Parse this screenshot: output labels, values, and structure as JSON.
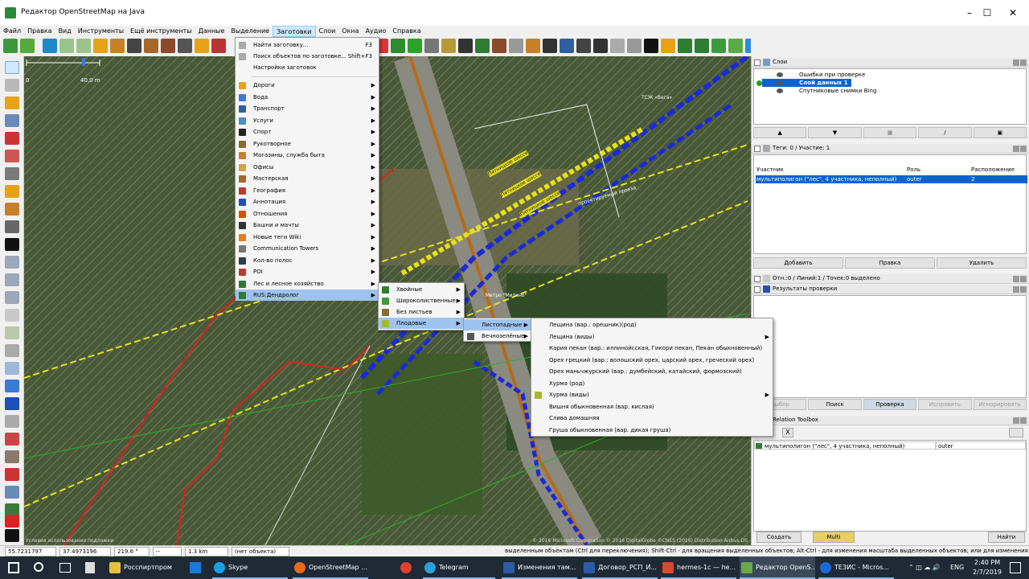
{
  "window": {
    "title": "Редактор OpenStreetMap на Java",
    "background_title": "...документы1 - Word"
  },
  "menubar": [
    "Файл",
    "Правка",
    "Вид",
    "Инструменты",
    "Ещё инструменты",
    "Данные",
    "Выделение",
    "Заготовки",
    "Слои",
    "Окна",
    "Аудио",
    "Справка"
  ],
  "map": {
    "scale_start": "0",
    "scale_end": "40,0 m",
    "attribution": "© 2016 Microsoft Corporation © 2016 DigitalGlobe ©CNES (2016) Distribution Airbus DS",
    "attribution_left": "Условия использования подложки",
    "labels": [
      "Метро \"Митино\"",
      "ТСЖ «Вега»"
    ],
    "street_labels": [
      "Пятницкое шоссе",
      "Пятницкое шоссе",
      "Пятницкое шоссе",
      "проектируемый проезд"
    ]
  },
  "presets_menu": {
    "top_items": [
      {
        "label": "Найти заготовку...",
        "shortcut": "F3"
      },
      {
        "label": "Поиск объектов по заготовке...",
        "shortcut": "Shift+F3"
      },
      {
        "label": "Настройки заготовок",
        "shortcut": ""
      }
    ],
    "groups": [
      {
        "label": "Дороги",
        "color": "#e8a21a"
      },
      {
        "label": "Вода",
        "color": "#3a7bd5"
      },
      {
        "label": "Транспорт",
        "color": "#2f5f9e"
      },
      {
        "label": "Услуги",
        "color": "#4a90c8"
      },
      {
        "label": "Спорт",
        "color": "#222222"
      },
      {
        "label": "Рукотворное",
        "color": "#8b6b2e"
      },
      {
        "label": "Магазины, служба быта",
        "color": "#c7802a"
      },
      {
        "label": "Офисы",
        "color": "#d2a24c"
      },
      {
        "label": "Мастерская",
        "color": "#a5682a"
      },
      {
        "label": "География",
        "color": "#c0392b"
      },
      {
        "label": "Аннотация",
        "color": "#1f4fb8"
      },
      {
        "label": "Отношения",
        "color": "#d35400"
      },
      {
        "label": "Башни и мачты",
        "color": "#333333"
      },
      {
        "label": "Новые теги Wiki",
        "color": "#e67e22"
      },
      {
        "label": "Communication Towers",
        "color": "#777777"
      },
      {
        "label": "Кол-во полос",
        "color": "#2c3e50"
      },
      {
        "label": "POI",
        "color": "#c0392b"
      },
      {
        "label": "Лес и лесное хозяйство",
        "color": "#2e7d32"
      },
      {
        "label": "RUS:Дендролог",
        "color": "#2e7d32"
      }
    ]
  },
  "dendrolog_menu": [
    {
      "label": "Хвойные"
    },
    {
      "label": "Широколиственные"
    },
    {
      "label": "Без листьев"
    },
    {
      "label": "Плодовые"
    }
  ],
  "fruit_menu": [
    {
      "label": "Листопадные"
    },
    {
      "label": "Вечнозелёные"
    }
  ],
  "deciduous_menu": [
    {
      "label": "Лещина (вар.: орешник)(род)",
      "sub": false
    },
    {
      "label": "Лещина (виды)",
      "sub": true
    },
    {
      "label": "Кария пекан (вар.: иллинойсская, Гикори пекан, Пекан обыкновенный)",
      "sub": false
    },
    {
      "label": "Орех грецкий (вар.: волошский орех, царский орех, греческий орех)",
      "sub": false
    },
    {
      "label": "Орех маньчжурский (вар.: думбейский, катайский, формозский)",
      "sub": false
    },
    {
      "label": "Хурма (род)",
      "sub": false
    },
    {
      "label": "Хурма (виды)",
      "sub": true
    },
    {
      "label": "Вишня обыкновенная (вар. кислая)",
      "sub": false
    },
    {
      "label": "Слива домашняя",
      "sub": false
    },
    {
      "label": "Груша обыкновенная (вар. дикая груша)",
      "sub": false
    }
  ],
  "layers_panel": {
    "title": "Слои",
    "layers": [
      "Ошибки при проверке",
      "Слой данных 1",
      "Спутниковые снимки Bing"
    ]
  },
  "tags_panel": {
    "title": "Теги: 0 / Участие: 1",
    "columns": [
      "Участник",
      "Роль",
      "Расположение"
    ],
    "row": {
      "member": "мультиполигон (\"лес\", 4 участника, неполный)",
      "role": "outer",
      "position": "2"
    },
    "buttons": [
      "Добавить",
      "Правка",
      "Удалить"
    ]
  },
  "selection_info": "Отн.:0 / Линий:1 / Точек:0 выделено",
  "validation_panel": {
    "title": "Результаты проверки",
    "buttons": [
      "Выбор",
      "Поиск",
      "Проверка",
      "Исправить",
      "Игнорировать"
    ]
  },
  "relation_toolbox": {
    "title": "Relation Toolbox",
    "row": {
      "name": "мультиполигон (\"лес\", 4 участника, неполный)",
      "role": "outer"
    },
    "buttons": [
      "Создать",
      "Multi",
      "Найти"
    ]
  },
  "statusbar": {
    "lat": "55.7231797",
    "lon": "37.4973196",
    "heading": "219.6 °",
    "angle": "--",
    "distance": "1.3 km",
    "object": "(нет объекта)",
    "help": "выделенным объектам (Ctrl для переключения); Shift-Ctrl - для вращения выделенных объектов; Alt-Ctrl - для изменения масштаба выделенных объектов; или для изменения выделения"
  },
  "taskbar": {
    "items": [
      "Росспиртпром",
      "Skype",
      "OpenStreetMap ...",
      "Telegram",
      "Изменения там...",
      "Договор_РСП_И...",
      "hermes-1c — he...",
      "Редактор OpenS...",
      "ТЕЗИС - Micros..."
    ],
    "lang": "ENG",
    "time": "2:40 PM",
    "date": "2/7/2019"
  },
  "colors": {
    "accent": "#0a64d0",
    "menu_highlight": "#9ec3ee",
    "taskbar": "#1f2a36"
  }
}
